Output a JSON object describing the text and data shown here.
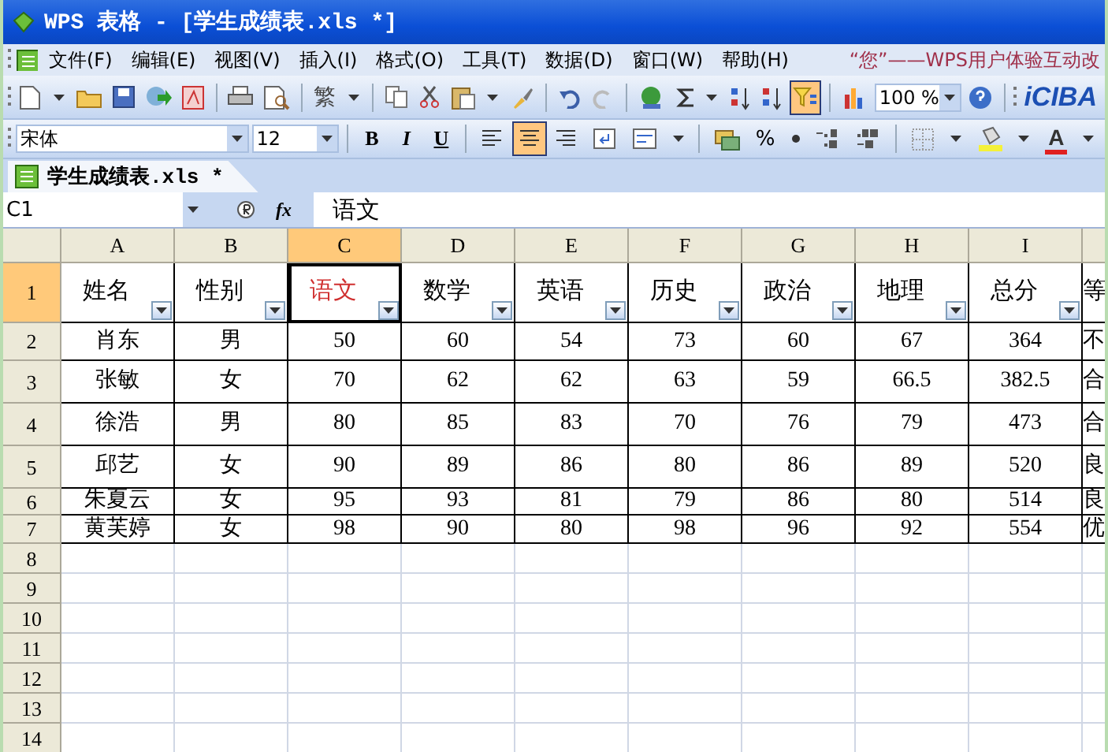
{
  "window": {
    "title": "WPS 表格 - [学生成绩表.xls *]"
  },
  "menu": {
    "items": [
      {
        "label": "文件(F)"
      },
      {
        "label": "编辑(E)"
      },
      {
        "label": "视图(V)"
      },
      {
        "label": "插入(I)"
      },
      {
        "label": "格式(O)"
      },
      {
        "label": "工具(T)"
      },
      {
        "label": "数据(D)"
      },
      {
        "label": "窗口(W)"
      },
      {
        "label": "帮助(H)"
      }
    ],
    "promo": "“您”——WPS用户体验互动改"
  },
  "standard_toolbar": {
    "traditional_label": "繁",
    "autofilter_selected": true,
    "zoom": "100 %",
    "brand": "iCIBA"
  },
  "format_toolbar": {
    "font": "宋体",
    "size": "12",
    "bold": "B",
    "italic": "I",
    "underline": "U",
    "align_buttons": [
      {
        "selected": false
      },
      {
        "selected": true
      },
      {
        "selected": false
      }
    ],
    "percent": "%",
    "font_color_label": "A"
  },
  "document_tab": {
    "label": "学生成绩表.xls *",
    "selected": true
  },
  "formula_bar": {
    "cell_reference": "C1",
    "function_label": "fx",
    "value": "语文"
  },
  "sheet": {
    "columns": [
      {
        "label": "A",
        "selected": false
      },
      {
        "label": "B",
        "selected": false
      },
      {
        "label": "C",
        "selected": true
      },
      {
        "label": "D",
        "selected": false
      },
      {
        "label": "E",
        "selected": false
      },
      {
        "label": "F",
        "selected": false
      },
      {
        "label": "G",
        "selected": false
      },
      {
        "label": "H",
        "selected": false
      },
      {
        "label": "I",
        "selected": false
      }
    ],
    "row_numbers": [
      {
        "label": "1",
        "selected": true
      },
      {
        "label": "2",
        "selected": false
      },
      {
        "label": "3",
        "selected": false
      },
      {
        "label": "4",
        "selected": false
      },
      {
        "label": "5",
        "selected": false
      },
      {
        "label": "6",
        "selected": false
      },
      {
        "label": "7",
        "selected": false
      },
      {
        "label": "8",
        "selected": false
      },
      {
        "label": "9",
        "selected": false
      },
      {
        "label": "10",
        "selected": false
      },
      {
        "label": "11",
        "selected": false
      },
      {
        "label": "12",
        "selected": false
      },
      {
        "label": "13",
        "selected": false
      },
      {
        "label": "14",
        "selected": false
      }
    ],
    "header_row": [
      {
        "text": "姓名",
        "selected": false
      },
      {
        "text": "性别",
        "selected": false
      },
      {
        "text": "语文",
        "selected": true
      },
      {
        "text": "数学",
        "selected": false
      },
      {
        "text": "英语",
        "selected": false
      },
      {
        "text": "历史",
        "selected": false
      },
      {
        "text": "政治",
        "selected": false
      },
      {
        "text": "地理",
        "selected": false
      },
      {
        "text": "总分",
        "selected": false
      },
      {
        "text": "等",
        "selected": false
      }
    ],
    "rows": [
      [
        "肖东",
        "男",
        "50",
        "60",
        "54",
        "73",
        "60",
        "67",
        "364",
        "不"
      ],
      [
        "张敏",
        "女",
        "70",
        "62",
        "62",
        "63",
        "59",
        "66.5",
        "382.5",
        "合"
      ],
      [
        "徐浩",
        "男",
        "80",
        "85",
        "83",
        "70",
        "76",
        "79",
        "473",
        "合"
      ],
      [
        "邱艺",
        "女",
        "90",
        "89",
        "86",
        "80",
        "86",
        "89",
        "520",
        "良"
      ],
      [
        "朱夏云",
        "女",
        "95",
        "93",
        "81",
        "79",
        "86",
        "80",
        "514",
        "良"
      ],
      [
        "黄芙婷",
        "女",
        "98",
        "90",
        "80",
        "98",
        "96",
        "92",
        "554",
        "优"
      ]
    ]
  }
}
